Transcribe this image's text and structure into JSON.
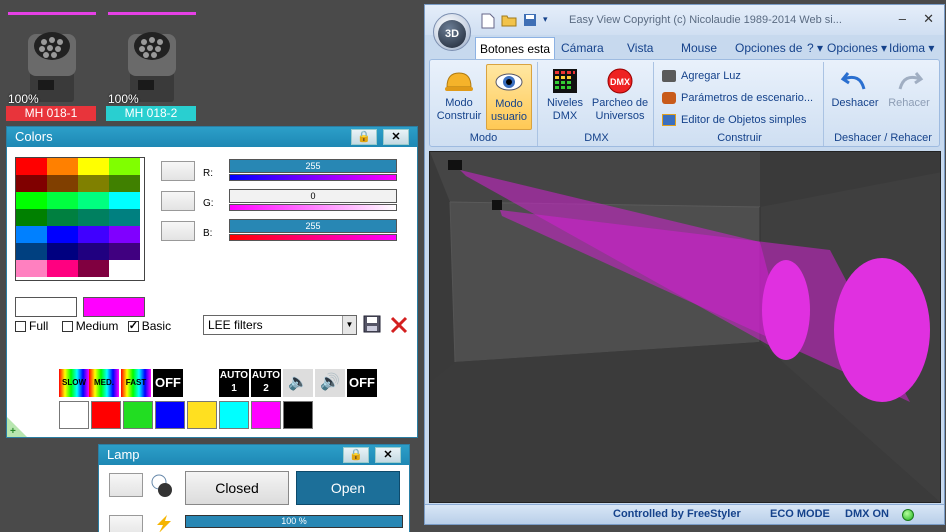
{
  "fixtures": [
    {
      "percent": "100%",
      "label": "MH 018-1",
      "label_color": "#e8343b"
    },
    {
      "percent": "100%",
      "label": "MH 018-2",
      "label_color": "#29cfd0"
    }
  ],
  "colors_panel": {
    "title": "Colors",
    "grid": [
      [
        "#ff0000",
        "#ff8000",
        "#ffff00",
        "#80ff00"
      ],
      [
        "#800000",
        "#803f00",
        "#808000",
        "#408000"
      ],
      [
        "#00ff00",
        "#00ff40",
        "#00ff80",
        "#00ffff"
      ],
      [
        "#008000",
        "#008040",
        "#008060",
        "#008080"
      ],
      [
        "#0080ff",
        "#0000ff",
        "#4000ff",
        "#8000ff"
      ],
      [
        "#004080",
        "#000080",
        "#200080",
        "#400080"
      ],
      [
        "#ff80c0",
        "#ff0080",
        "#800040",
        "#ffffff"
      ]
    ],
    "channels": [
      {
        "name": "R:",
        "value": "255",
        "fill": 1.0,
        "track_color": "#ff00ff"
      },
      {
        "name": "G:",
        "value": "0",
        "fill": 0.0,
        "track_color": "#ff00ff"
      },
      {
        "name": "B:",
        "value": "255",
        "fill": 1.0,
        "track_color": "#ff0000"
      }
    ],
    "preview_current": "#ffffff",
    "preview_target": "#ff00ff",
    "checks": [
      {
        "label": "Full",
        "checked": false
      },
      {
        "label": "Medium",
        "checked": false
      },
      {
        "label": "Basic",
        "checked": true
      }
    ],
    "filter_select": "LEE filters",
    "effects": [
      {
        "label": "SLOW",
        "type": "rainbow"
      },
      {
        "label": "MED.",
        "type": "rainbow"
      },
      {
        "label": "FAST",
        "type": "rainbow"
      },
      {
        "label": "OFF",
        "type": "text"
      },
      {
        "label": "AUTO 1",
        "type": "text"
      },
      {
        "label": "AUTO 2",
        "type": "text"
      },
      {
        "label": "speaker-icon",
        "type": "icon"
      },
      {
        "label": "speaker-on-icon",
        "type": "icon"
      },
      {
        "label": "OFF",
        "type": "text"
      }
    ],
    "color_tiles": [
      "#ffffff",
      "#ff0000",
      "#22dd22",
      "#0000ff",
      "#ffe020",
      "#00ffff",
      "#ff00ff",
      "#000000"
    ]
  },
  "lamp_panel": {
    "title": "Lamp",
    "closed_label": "Closed",
    "open_label": "Open",
    "percent": "100 %"
  },
  "app": {
    "orb_label": "3D",
    "title": "Easy View  Copyright (c) Nicolaudie 1989-2014   Web si...",
    "tabs": [
      "Botones esta",
      "Cámara",
      "Vista",
      "Mouse",
      "Opciones de",
      "?",
      "Opciones",
      "Idioma"
    ],
    "groups": {
      "modo": {
        "label": "Modo",
        "buttons": [
          {
            "line1": "Modo",
            "line2": "Construir"
          },
          {
            "line1": "Modo",
            "line2": "usuario"
          }
        ]
      },
      "dmx": {
        "label": "DMX",
        "buttons": [
          {
            "line1": "Niveles",
            "line2": "DMX"
          },
          {
            "line1": "Parcheo de",
            "line2": "Universos"
          }
        ]
      },
      "construir": {
        "label": "Construir",
        "items": [
          "Agregar Luz",
          "Parámetros de escenario...",
          "Editor de Objetos simples"
        ]
      },
      "deshacer": {
        "label": "Deshacer / Rehacer",
        "undo": "Deshacer",
        "redo": "Rehacer"
      }
    },
    "status": {
      "controlled": "Controlled by FreeStyler",
      "eco": "ECO MODE",
      "dmx": "DMX ON"
    }
  }
}
